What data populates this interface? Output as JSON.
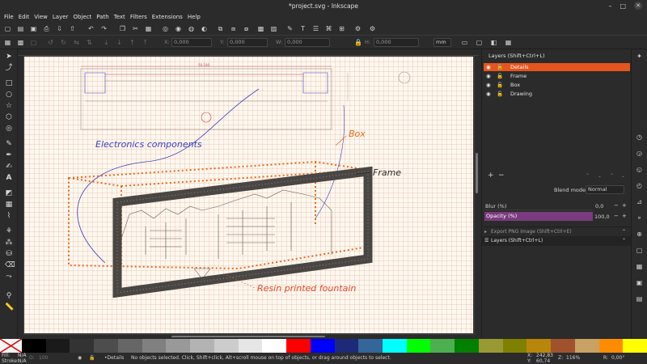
{
  "window": {
    "title": "*project.svg - Inkscape",
    "controls": {
      "minimize": "–",
      "maximize": "□",
      "close": "✕"
    }
  },
  "menubar": [
    "File",
    "Edit",
    "View",
    "Layer",
    "Object",
    "Path",
    "Text",
    "Filters",
    "Extensions",
    "Help"
  ],
  "tool_controls": {
    "x_label": "X:",
    "x_value": "0,000",
    "y_label": "Y:",
    "y_value": "0,000",
    "w_label": "W:",
    "w_value": "0,000",
    "h_label": "H:",
    "h_value": "0,000",
    "unit": "mm"
  },
  "canvas": {
    "labels": {
      "electronics": "Electronics components",
      "box": "Box",
      "frame": "Frame",
      "fountain": "Resin printed fountain"
    },
    "colors": {
      "blue": "#3c3fbf",
      "orange": "#ea6a1b",
      "frame": "#4a4643",
      "sketch": "#6a6058"
    }
  },
  "layers_panel": {
    "title": "Layers (Shift+Ctrl+L)",
    "layers": [
      {
        "name": "Details",
        "selected": true
      },
      {
        "name": "Frame",
        "selected": false
      },
      {
        "name": "Box",
        "selected": false
      },
      {
        "name": "Drawing",
        "selected": false
      }
    ],
    "add": "+",
    "remove": "−",
    "blend_mode_label": "Blend mode:",
    "blend_mode_value": "Normal",
    "blur_label": "Blur (%)",
    "blur_value": "0,0",
    "opacity_label": "Opacity (%)",
    "opacity_value": "100,0",
    "opacity_level": 1.0,
    "export_dock": "Export PNG Image (Shift+Ctrl+E)",
    "layers_dock": "Layers (Shift+Ctrl+L)"
  },
  "palette": [
    "#000000",
    "#1a1a1a",
    "#333333",
    "#4d4d4d",
    "#666666",
    "#808080",
    "#999999",
    "#b3b3b3",
    "#cccccc",
    "#e6e6e6",
    "#ffffff",
    "#ff0000",
    "#0000ff",
    "#1e2a78",
    "#336699",
    "#00ffff",
    "#00ff00",
    "#4caf50",
    "#008000",
    "#999933",
    "#808000",
    "#b8860b",
    "#a0522d",
    "#c8a165",
    "#ff8c00",
    "#ffff00"
  ],
  "status": {
    "fill_label": "Fill:",
    "fill_value": "N/A",
    "stroke_label": "Stroke:",
    "stroke_value": "N/A",
    "opacity_label": "O:",
    "opacity_value": "100",
    "layer": "•Details",
    "message": "No objects selected. Click, Shift+click, Alt+scroll mouse on top of objects, or drag around objects to select.",
    "x_label": "X:",
    "x_value": "242,83",
    "y_label": "Y:",
    "y_value": "60,74",
    "zoom_label": "Z:",
    "zoom_value": "116%",
    "rotation_label": "R:",
    "rotation_value": "0,00°"
  }
}
